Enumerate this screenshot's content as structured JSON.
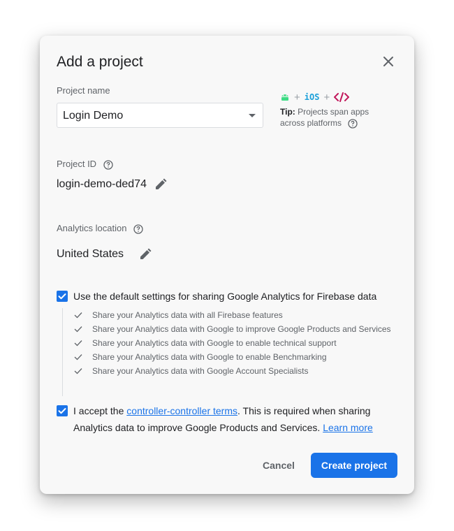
{
  "dialog": {
    "title": "Add a project",
    "close_icon": "close-icon"
  },
  "project_name": {
    "label": "Project name",
    "value": "Login Demo"
  },
  "tip": {
    "icons": [
      "android-icon",
      "ios-icon",
      "web-code-icon"
    ],
    "ios_text": "iOS",
    "plus": "+",
    "label": "Tip:",
    "text": "Projects span apps across platforms"
  },
  "project_id": {
    "label": "Project ID",
    "value": "login-demo-ded74"
  },
  "analytics_location": {
    "label": "Analytics location",
    "value": "United States"
  },
  "default_settings": {
    "checked": true,
    "label": "Use the default settings for sharing Google Analytics for Firebase data",
    "items": [
      "Share your Analytics data with all Firebase features",
      "Share your Analytics data with Google to improve Google Products and Services",
      "Share your Analytics data with Google to enable technical support",
      "Share your Analytics data with Google to enable Benchmarking",
      "Share your Analytics data with Google Account Specialists"
    ]
  },
  "terms": {
    "checked": true,
    "prefix": "I accept the ",
    "link": "controller-controller terms",
    "suffix": ". This is required when sharing",
    "line2": "Analytics data to improve Google Products and Services. ",
    "learn_more": "Learn more"
  },
  "actions": {
    "cancel": "Cancel",
    "create": "Create project"
  },
  "colors": {
    "accent": "#1a73e8",
    "android": "#3ddc84",
    "ios": "#1a9fd9",
    "web": "#c2185b"
  }
}
